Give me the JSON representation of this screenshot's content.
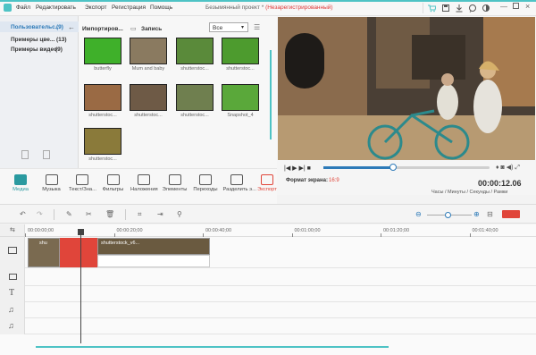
{
  "menu": [
    "Файл",
    "Редактировать",
    "Экспорт",
    "Регистрация",
    "Помощь"
  ],
  "window": {
    "title": "Безымянный проект *",
    "unregistered": "(Незарегистрированный)"
  },
  "sidebar": {
    "items": [
      {
        "label": "Пользовательс...",
        "count": "(9)"
      },
      {
        "label": "Примеры цве...",
        "count": "(13)"
      },
      {
        "label": "Примеры видео",
        "count": "(9)"
      }
    ]
  },
  "media": {
    "import_label": "Импортиров...",
    "record_label": "Запись",
    "filter_value": "Все",
    "thumbnails": [
      {
        "label": "butterfly",
        "color": "#3fb02a"
      },
      {
        "label": "Mum and baby",
        "color": "#8a7a60"
      },
      {
        "label": "shutterstoc...",
        "color": "#5a8a3a"
      },
      {
        "label": "shutterstoc...",
        "color": "#4d9b2e"
      },
      {
        "label": "shutterstoc...",
        "color": "#9a6a44"
      },
      {
        "label": "shutterstoc...",
        "color": "#6e5a46"
      },
      {
        "label": "shutterstoc...",
        "color": "#6f7f4f"
      },
      {
        "label": "Snapshot_4",
        "color": "#5aa83a"
      },
      {
        "label": "shutterstoc...",
        "color": "#8a7a3a"
      }
    ]
  },
  "toolbar": {
    "items": [
      {
        "label": "Медиа",
        "icon": "media-icon",
        "active": true
      },
      {
        "label": "Музыка",
        "icon": "music-icon"
      },
      {
        "label": "Текст/Зна...",
        "icon": "text-icon"
      },
      {
        "label": "Фильтры",
        "icon": "filter-icon"
      },
      {
        "label": "Наложения",
        "icon": "overlay-icon"
      },
      {
        "label": "Элементы",
        "icon": "elements-icon"
      },
      {
        "label": "Переходы",
        "icon": "transition-icon"
      },
      {
        "label": "Разделить э...",
        "icon": "split-screen-icon"
      },
      {
        "label": "Экспорт",
        "icon": "export-icon"
      }
    ]
  },
  "player": {
    "time": "00:00:12.06",
    "aspect_label": "Формат экрана:",
    "aspect_value": "16:9",
    "time_format": "Часы / Минуты / Секунды / Рамки",
    "progress": 0.42
  },
  "timeline": {
    "ticks": [
      "00:00:00;00",
      "00:00:20;00",
      "00:00:40;00",
      "00:01:00;00",
      "00:01:20;00",
      "00:01:40;00"
    ],
    "clip_labels": [
      "shu",
      "shutterstock_v6..."
    ]
  },
  "colors": {
    "accent": "#4ec3c5",
    "red": "#e0453a",
    "blue": "#2d7ab8"
  }
}
